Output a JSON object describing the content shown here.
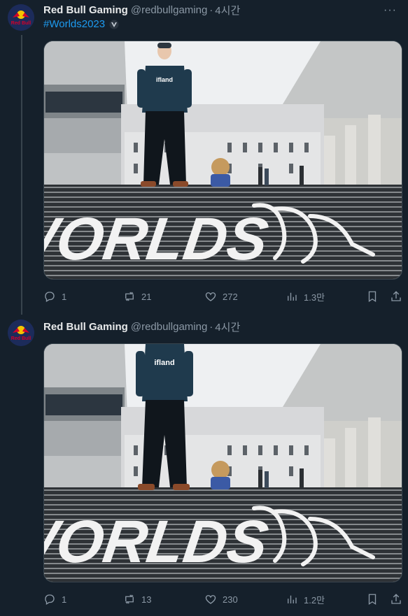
{
  "tweets": [
    {
      "author_name": "Red Bull Gaming",
      "handle": "@redbullgaming",
      "separator": "·",
      "time": "4시간",
      "hashtag": "#Worlds2023",
      "media_text": "WORLDS",
      "shirt_text": "ifland",
      "avatar_text": "Red Bull",
      "replies": "1",
      "retweets": "21",
      "likes": "272",
      "views": "1.3만"
    },
    {
      "author_name": "Red Bull Gaming",
      "handle": "@redbullgaming",
      "separator": "·",
      "time": "4시간",
      "media_text": "WORLDS",
      "shirt_text": "ifland",
      "avatar_text": "Red Bull",
      "replies": "1",
      "retweets": "13",
      "likes": "230",
      "views": "1.2만"
    }
  ],
  "icons": {
    "more": "more-icon",
    "reply": "reply-icon",
    "retweet": "retweet-icon",
    "like": "like-icon",
    "views": "views-icon",
    "bookmark": "bookmark-icon",
    "share": "share-icon"
  },
  "colors": {
    "background": "#15202b",
    "accent": "#1d9bf0",
    "muted": "#8b98a5",
    "text": "#e7e9ea"
  }
}
